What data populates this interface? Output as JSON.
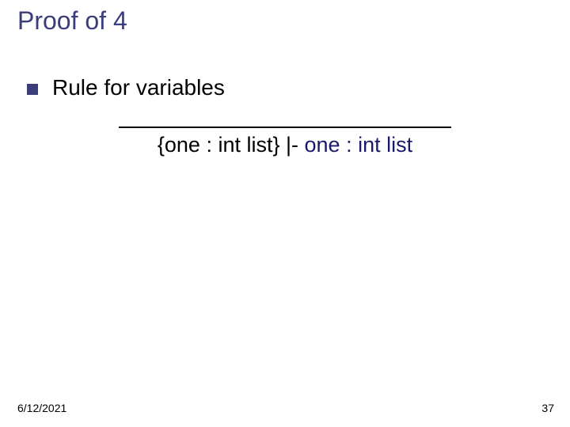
{
  "title": "Proof of 4",
  "bullet": {
    "text": "Rule for variables"
  },
  "rule": {
    "context": "{one : int list} |- ",
    "var": "one",
    "colon": " : ",
    "type": "int list"
  },
  "footer": {
    "date": "6/12/2021",
    "page": "37"
  }
}
